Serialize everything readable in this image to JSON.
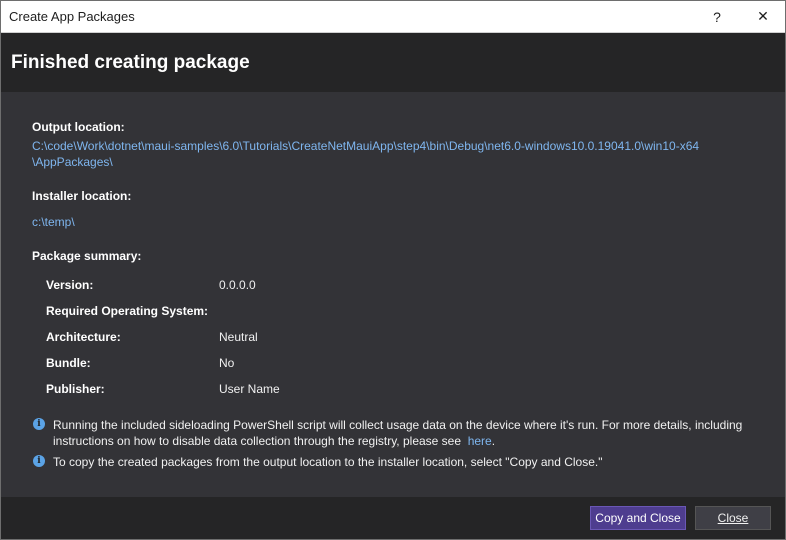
{
  "window": {
    "title": "Create App Packages",
    "help_glyph": "?",
    "close_glyph": "✕"
  },
  "header": {
    "heading": "Finished creating package"
  },
  "output": {
    "label": "Output location:",
    "path_line1": "C:\\code\\Work\\dotnet\\maui-samples\\6.0\\Tutorials\\CreateNetMauiApp\\step4\\bin\\Debug\\net6.0-windows10.0.19041.0\\win10-x64",
    "path_line2": "\\AppPackages\\"
  },
  "installer": {
    "label": "Installer location:",
    "path": "c:\\temp\\"
  },
  "summary": {
    "label": "Package summary:",
    "rows": [
      {
        "key": "Version:",
        "value": "0.0.0.0"
      },
      {
        "key": "Required Operating System:",
        "value": ""
      },
      {
        "key": "Architecture:",
        "value": "Neutral"
      },
      {
        "key": "Bundle:",
        "value": "No"
      },
      {
        "key": "Publisher:",
        "value": "User Name"
      }
    ]
  },
  "info": [
    {
      "line1": "Running the included sideloading PowerShell script will collect usage data on the device where it's run.  For more details, including",
      "line2": "instructions on how to disable data collection through the registry, please see",
      "link": "here",
      "suffix": "."
    },
    {
      "line1": "To copy the created packages from the output location to the installer location, select \"Copy and Close.\""
    }
  ],
  "buttons": {
    "copy_and_close": "Copy and Close",
    "close": "Close"
  },
  "colors": {
    "accent": "#4e3d8f",
    "link": "#7fb6ef",
    "info_icon": "#5ba3e6"
  }
}
